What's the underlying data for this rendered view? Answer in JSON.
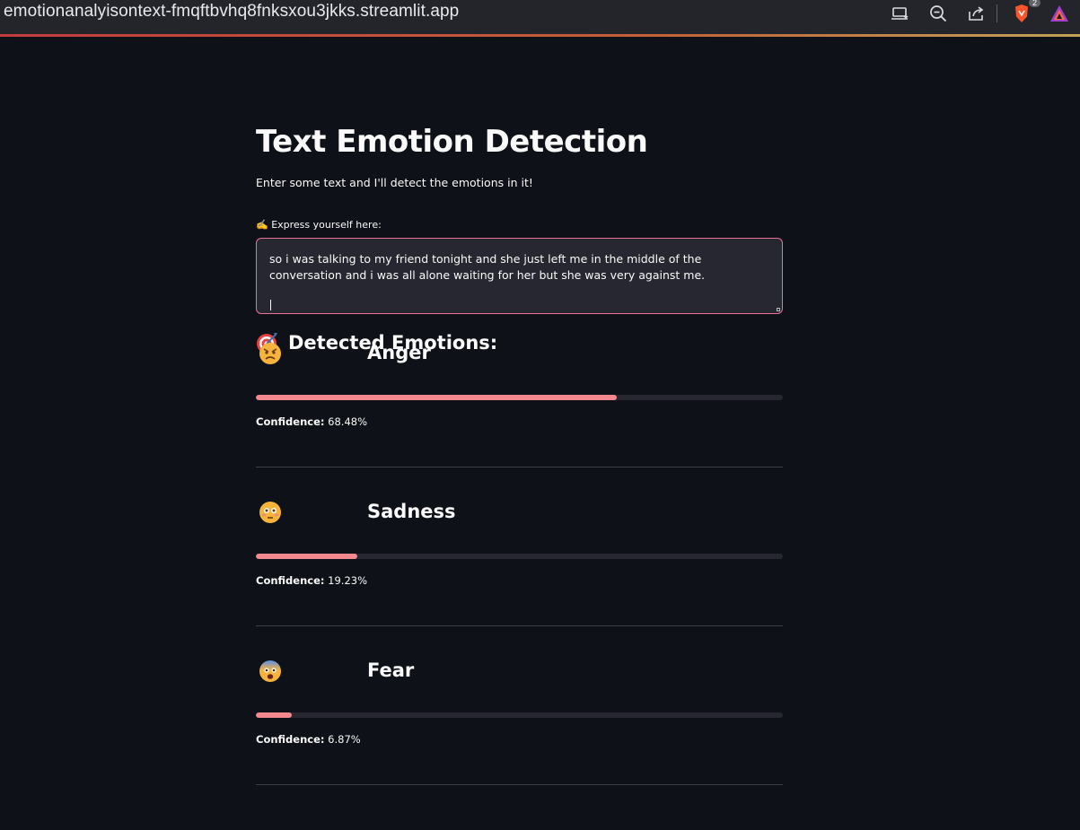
{
  "browser": {
    "url": "emotionanalyisontext-fmqftbvhq8fnksxou3jkks.streamlit.app",
    "icons": [
      "install-app-icon",
      "zoom-out-icon",
      "share-icon",
      "brave-shield-icon",
      "brave-rewards-icon"
    ],
    "brave_badge": "2"
  },
  "app": {
    "title": "Text Emotion Detection",
    "subtitle": "Enter some text and I'll detect the emotions in it!",
    "input_label": "✍️ Express yourself here:",
    "input_value": "so i was talking to my friend tonight and she just left me in the middle of the conversation and i was all alone waiting for her but she was very against me.",
    "results_heading": "Detected Emotions:",
    "confidence_label": "Confidence:",
    "emotions": [
      {
        "icon": "angry-face-icon",
        "name": "Anger",
        "confidence_text": "68.48%",
        "confidence": 0.6848
      },
      {
        "icon": "flushed-face-icon",
        "name": "Sadness",
        "confidence_text": "19.23%",
        "confidence": 0.1923
      },
      {
        "icon": "fearful-face-icon",
        "name": "Fear",
        "confidence_text": "6.87%",
        "confidence": 0.0687
      }
    ]
  },
  "colors": {
    "background": "#0e1117",
    "progress_fill": "#f2898e",
    "progress_track": "#262730",
    "input_border": "#e8739a"
  }
}
